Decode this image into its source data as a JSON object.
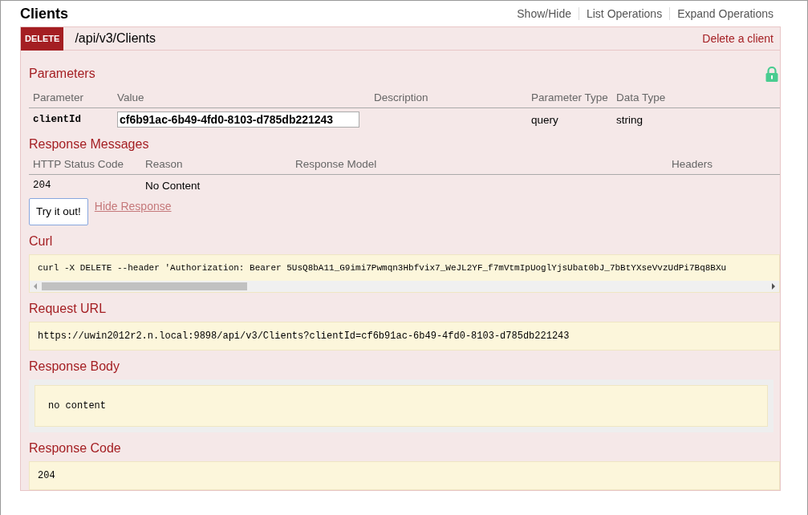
{
  "title": "Clients",
  "header_links": [
    "Show/Hide",
    "List Operations",
    "Expand Operations"
  ],
  "operation": {
    "method": "DELETE",
    "path": "/api/v3/Clients",
    "summary": "Delete a client"
  },
  "parameters": {
    "heading": "Parameters",
    "columns": [
      "Parameter",
      "Value",
      "Description",
      "Parameter Type",
      "Data Type"
    ],
    "rows": [
      {
        "parameter": "clientId",
        "value": "cf6b91ac-6b49-4fd0-8103-d785db221243",
        "parameter_type": "query",
        "data_type": "string"
      }
    ]
  },
  "response_messages": {
    "heading": "Response Messages",
    "columns": [
      "HTTP Status Code",
      "Reason",
      "Response Model",
      "Headers"
    ],
    "rows": [
      {
        "code": "204",
        "reason": "No Content"
      }
    ]
  },
  "try_button": "Try it out!",
  "hide_response": "Hide Response",
  "curl": {
    "heading": "Curl",
    "command": "curl -X DELETE --header 'Authorization: Bearer 5UsQ8bA11_G9imi7Pwmqn3Hbfvix7_WeJL2YF_f7mVtmIpUoglYjsUbat0bJ_7bBtYXseVvzUdPi7Bq8BXu"
  },
  "request_url": {
    "heading": "Request URL",
    "url": "https://uwin2012r2.n.local:9898/api/v3/Clients?clientId=cf6b91ac-6b49-4fd0-8103-d785db221243"
  },
  "response_body": {
    "heading": "Response Body",
    "body": "no content"
  },
  "response_code": {
    "heading": "Response Code",
    "code": "204"
  }
}
